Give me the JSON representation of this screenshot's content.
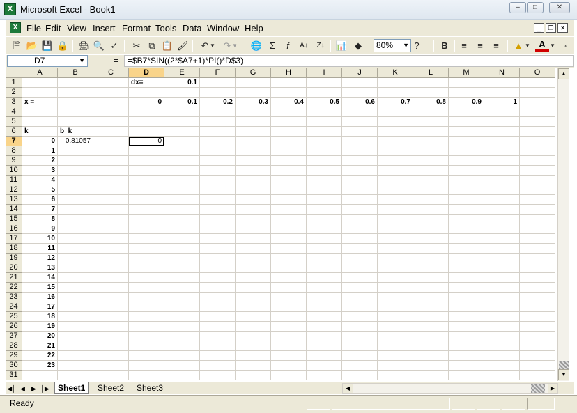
{
  "window": {
    "title": "Microsoft Excel - Book1",
    "app_icon_letter": "X"
  },
  "menu": [
    "File",
    "Edit",
    "View",
    "Insert",
    "Format",
    "Tools",
    "Data",
    "Window",
    "Help"
  ],
  "toolbar": {
    "zoom": "80%",
    "bold_label": "B",
    "font_color_label": "A"
  },
  "formula_bar": {
    "name_box": "D7",
    "equals": "=",
    "formula": "=$B7*SIN((2*$A7+1)*PI()*D$3)"
  },
  "columns": [
    "A",
    "B",
    "C",
    "D",
    "E",
    "F",
    "G",
    "H",
    "I",
    "J",
    "K",
    "L",
    "M",
    "N",
    "O"
  ],
  "rows": [
    "1",
    "2",
    "3",
    "4",
    "5",
    "6",
    "7",
    "8",
    "9",
    "10",
    "11",
    "12",
    "13",
    "14",
    "15",
    "16",
    "17",
    "18",
    "19",
    "20",
    "21",
    "22",
    "23",
    "24",
    "25",
    "26",
    "27",
    "28",
    "29",
    "30",
    "31"
  ],
  "active": {
    "column": "D",
    "row": "7"
  },
  "cells": {
    "D1": "dx=",
    "E1": "0.1",
    "A3": "x =",
    "D3": "0",
    "E3": "0.1",
    "F3": "0.2",
    "G3": "0.3",
    "H3": "0.4",
    "I3": "0.5",
    "J3": "0.6",
    "K3": "0.7",
    "L3": "0.8",
    "M3": "0.9",
    "N3": "1",
    "A6": "k",
    "B6": "b_k",
    "A7": "0",
    "B7": "0.81057",
    "D7": "0",
    "A8": "1",
    "A9": "2",
    "A10": "3",
    "A11": "4",
    "A12": "5",
    "A13": "6",
    "A14": "7",
    "A15": "8",
    "A16": "9",
    "A17": "10",
    "A18": "11",
    "A19": "12",
    "A20": "13",
    "A21": "14",
    "A22": "15",
    "A23": "16",
    "A24": "17",
    "A25": "18",
    "A26": "19",
    "A27": "20",
    "A28": "21",
    "A29": "22",
    "A30": "23"
  },
  "sheets": [
    "Sheet1",
    "Sheet2",
    "Sheet3"
  ],
  "active_sheet": "Sheet1",
  "status": "Ready"
}
